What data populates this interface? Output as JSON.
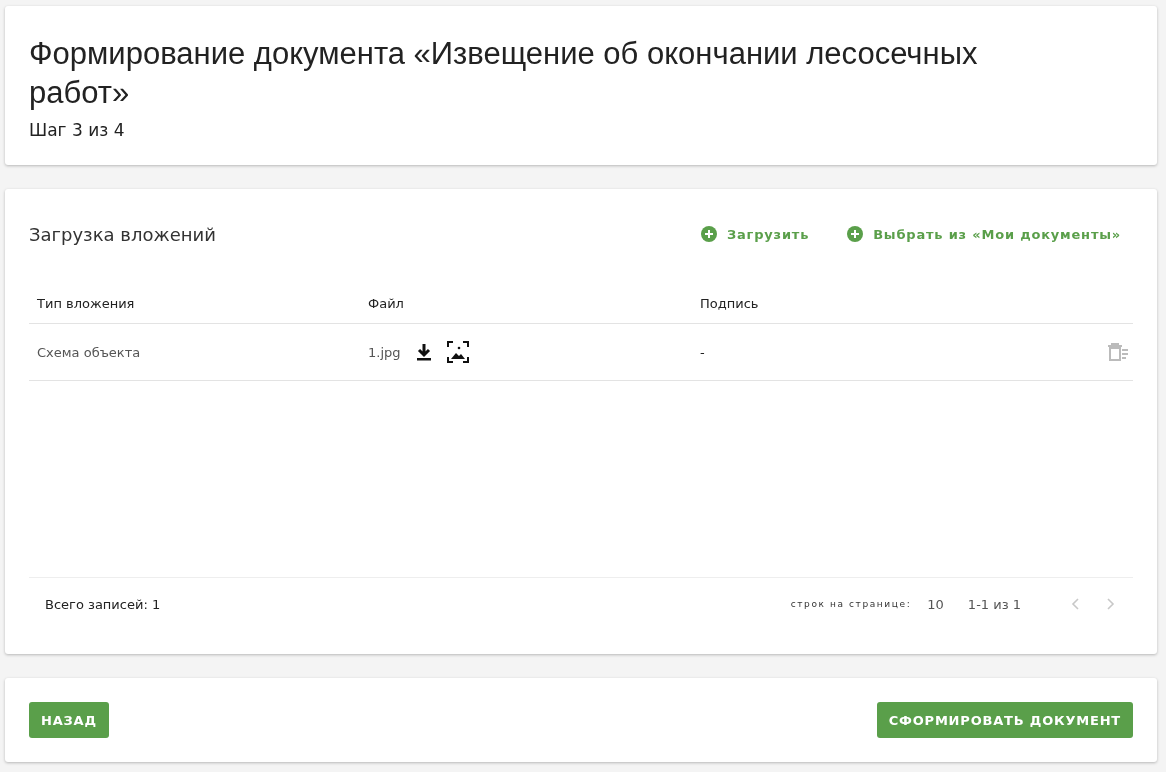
{
  "header": {
    "title": "Формирование документа «Извещение об окончании лесосечных работ»",
    "step": "Шаг 3 из 4"
  },
  "attachments": {
    "title": "Загрузка вложений",
    "actions": [
      {
        "label": "Загрузить"
      },
      {
        "label": "Выбрать из «Мои документы»"
      }
    ],
    "columns": [
      "Тип вложения",
      "Файл",
      "Подпись"
    ],
    "rows": [
      {
        "type": "Схема объекта",
        "file": "1.jpg",
        "signature": "-"
      }
    ],
    "total": "Всего записей: 1",
    "rows_per_page_label": "строк на странице:",
    "rows_per_page": "10",
    "range": "1-1 из 1",
    "prev_disabled": true,
    "next_disabled": true
  },
  "footer": {
    "back": "НАЗАД",
    "submit": "СФОРМИРОВАТЬ ДОКУМЕНТ"
  }
}
